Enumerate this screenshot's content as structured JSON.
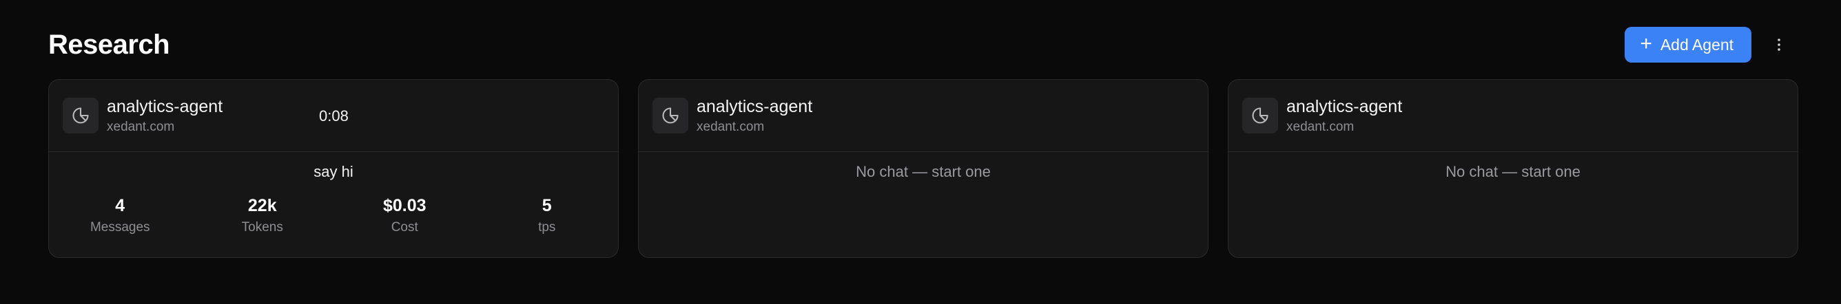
{
  "header": {
    "title": "Research",
    "add_button_label": "Add Agent"
  },
  "icons": {
    "add": "plus-icon",
    "more": "kebab-menu-icon",
    "agent": "pie-chart-icon"
  },
  "colors": {
    "accent": "#3b82f6",
    "background": "#0a0a0b",
    "card": "#161617"
  },
  "cards": [
    {
      "agent_name": "analytics-agent",
      "domain": "xedant.com",
      "timer": "0:08",
      "chat_title": "say hi",
      "stats": [
        {
          "value": "4",
          "label": "Messages"
        },
        {
          "value": "22k",
          "label": "Tokens"
        },
        {
          "value": "$0.03",
          "label": "Cost"
        },
        {
          "value": "5",
          "label": "tps"
        }
      ]
    },
    {
      "agent_name": "analytics-agent",
      "domain": "xedant.com",
      "empty_text": "No chat — start one"
    },
    {
      "agent_name": "analytics-agent",
      "domain": "xedant.com",
      "empty_text": "No chat — start one"
    }
  ]
}
